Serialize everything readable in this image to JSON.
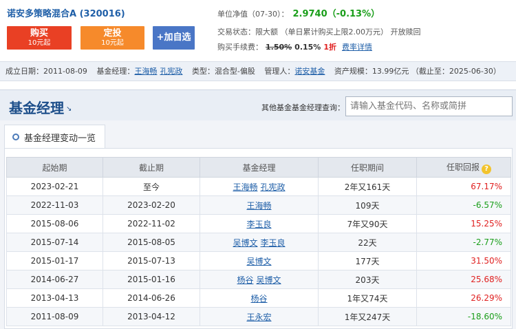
{
  "header": {
    "fund_title": "诺安多策略混合A (320016)",
    "buy": {
      "label": "购买",
      "sub": "10元起"
    },
    "sip": {
      "label": "定投",
      "sub": "10元起"
    },
    "fav_label": "+加自选",
    "nav_label": "单位净值（07-30）：",
    "nav_value": "2.9740（-0.13%）",
    "trade_status": "交易状态：限大额 （单日累计购买上限2.00万元） 开放赎回",
    "fee_label": "购买手续费：",
    "fee_old": "1.50%",
    "fee_new": "0.15%",
    "fee_discount": "1折",
    "fee_link": "费率详情"
  },
  "info_bar": {
    "inception_label": "成立日期：",
    "inception_value": "2011-08-09",
    "manager_label": "基金经理：",
    "managers": [
      "王海畅",
      "孔宪政"
    ],
    "type_label": "类型：",
    "type_value": "混合型-偏股",
    "company_label": "管理人：",
    "company_value": "诺安基金",
    "size_label": "资产规模：",
    "size_value": "13.99亿元 （截止至：2025-06-30）"
  },
  "section": {
    "title": "基金经理",
    "search_label": "其他基金基金经理查询：",
    "search_placeholder": "请输入基金代码、名称或简拼"
  },
  "tab_label": "基金经理变动一览",
  "table": {
    "headers": [
      "起始期",
      "截止期",
      "基金经理",
      "任职期间",
      "任职回报"
    ],
    "rows": [
      {
        "start": "2023-02-21",
        "end": "至今",
        "managers": [
          "王海畅",
          "孔宪政"
        ],
        "tenure": "2年又161天",
        "return": "67.17%"
      },
      {
        "start": "2022-11-03",
        "end": "2023-02-20",
        "managers": [
          "王海畅"
        ],
        "tenure": "109天",
        "return": "-6.57%"
      },
      {
        "start": "2015-08-06",
        "end": "2022-11-02",
        "managers": [
          "李玉良"
        ],
        "tenure": "7年又90天",
        "return": "15.25%"
      },
      {
        "start": "2015-07-14",
        "end": "2015-08-05",
        "managers": [
          "吴博文",
          "李玉良"
        ],
        "tenure": "22天",
        "return": "-2.77%"
      },
      {
        "start": "2015-01-17",
        "end": "2015-07-13",
        "managers": [
          "吴博文"
        ],
        "tenure": "177天",
        "return": "31.50%"
      },
      {
        "start": "2014-06-27",
        "end": "2015-01-16",
        "managers": [
          "杨谷",
          "吴博文"
        ],
        "tenure": "203天",
        "return": "25.68%"
      },
      {
        "start": "2013-04-13",
        "end": "2014-06-26",
        "managers": [
          "杨谷"
        ],
        "tenure": "1年又74天",
        "return": "26.29%"
      },
      {
        "start": "2011-08-09",
        "end": "2013-04-12",
        "managers": [
          "王永宏"
        ],
        "tenure": "1年又247天",
        "return": "-18.60%"
      }
    ]
  },
  "colors": {
    "positive": "#e02020",
    "negative": "#1a9e1a",
    "link": "#1f5fa8"
  },
  "icons": {
    "help": "question-icon"
  }
}
